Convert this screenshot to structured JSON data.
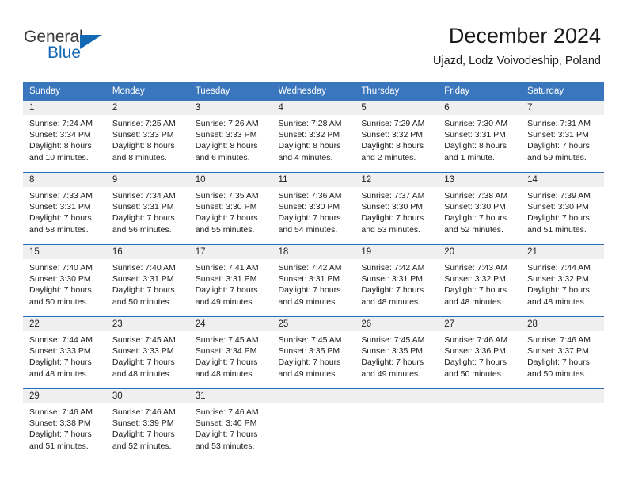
{
  "brand": {
    "name_part1": "General",
    "name_part2": "Blue",
    "triangle_color": "#1268b3"
  },
  "header": {
    "title": "December 2024",
    "subtitle": "Ujazd, Lodz Voivodeship, Poland"
  },
  "theme": {
    "header_bg": "#3a76bd",
    "row_divider": "#2f6eb5",
    "daynum_band_bg": "#efeff0",
    "page_bg": "#ffffff"
  },
  "weekday_headers": [
    "Sunday",
    "Monday",
    "Tuesday",
    "Wednesday",
    "Thursday",
    "Friday",
    "Saturday"
  ],
  "weeks": [
    [
      {
        "day": "1",
        "sunrise": "Sunrise: 7:24 AM",
        "sunset": "Sunset: 3:34 PM",
        "daylight_line1": "Daylight: 8 hours",
        "daylight_line2": "and 10 minutes."
      },
      {
        "day": "2",
        "sunrise": "Sunrise: 7:25 AM",
        "sunset": "Sunset: 3:33 PM",
        "daylight_line1": "Daylight: 8 hours",
        "daylight_line2": "and 8 minutes."
      },
      {
        "day": "3",
        "sunrise": "Sunrise: 7:26 AM",
        "sunset": "Sunset: 3:33 PM",
        "daylight_line1": "Daylight: 8 hours",
        "daylight_line2": "and 6 minutes."
      },
      {
        "day": "4",
        "sunrise": "Sunrise: 7:28 AM",
        "sunset": "Sunset: 3:32 PM",
        "daylight_line1": "Daylight: 8 hours",
        "daylight_line2": "and 4 minutes."
      },
      {
        "day": "5",
        "sunrise": "Sunrise: 7:29 AM",
        "sunset": "Sunset: 3:32 PM",
        "daylight_line1": "Daylight: 8 hours",
        "daylight_line2": "and 2 minutes."
      },
      {
        "day": "6",
        "sunrise": "Sunrise: 7:30 AM",
        "sunset": "Sunset: 3:31 PM",
        "daylight_line1": "Daylight: 8 hours",
        "daylight_line2": "and 1 minute."
      },
      {
        "day": "7",
        "sunrise": "Sunrise: 7:31 AM",
        "sunset": "Sunset: 3:31 PM",
        "daylight_line1": "Daylight: 7 hours",
        "daylight_line2": "and 59 minutes."
      }
    ],
    [
      {
        "day": "8",
        "sunrise": "Sunrise: 7:33 AM",
        "sunset": "Sunset: 3:31 PM",
        "daylight_line1": "Daylight: 7 hours",
        "daylight_line2": "and 58 minutes."
      },
      {
        "day": "9",
        "sunrise": "Sunrise: 7:34 AM",
        "sunset": "Sunset: 3:31 PM",
        "daylight_line1": "Daylight: 7 hours",
        "daylight_line2": "and 56 minutes."
      },
      {
        "day": "10",
        "sunrise": "Sunrise: 7:35 AM",
        "sunset": "Sunset: 3:30 PM",
        "daylight_line1": "Daylight: 7 hours",
        "daylight_line2": "and 55 minutes."
      },
      {
        "day": "11",
        "sunrise": "Sunrise: 7:36 AM",
        "sunset": "Sunset: 3:30 PM",
        "daylight_line1": "Daylight: 7 hours",
        "daylight_line2": "and 54 minutes."
      },
      {
        "day": "12",
        "sunrise": "Sunrise: 7:37 AM",
        "sunset": "Sunset: 3:30 PM",
        "daylight_line1": "Daylight: 7 hours",
        "daylight_line2": "and 53 minutes."
      },
      {
        "day": "13",
        "sunrise": "Sunrise: 7:38 AM",
        "sunset": "Sunset: 3:30 PM",
        "daylight_line1": "Daylight: 7 hours",
        "daylight_line2": "and 52 minutes."
      },
      {
        "day": "14",
        "sunrise": "Sunrise: 7:39 AM",
        "sunset": "Sunset: 3:30 PM",
        "daylight_line1": "Daylight: 7 hours",
        "daylight_line2": "and 51 minutes."
      }
    ],
    [
      {
        "day": "15",
        "sunrise": "Sunrise: 7:40 AM",
        "sunset": "Sunset: 3:30 PM",
        "daylight_line1": "Daylight: 7 hours",
        "daylight_line2": "and 50 minutes."
      },
      {
        "day": "16",
        "sunrise": "Sunrise: 7:40 AM",
        "sunset": "Sunset: 3:31 PM",
        "daylight_line1": "Daylight: 7 hours",
        "daylight_line2": "and 50 minutes."
      },
      {
        "day": "17",
        "sunrise": "Sunrise: 7:41 AM",
        "sunset": "Sunset: 3:31 PM",
        "daylight_line1": "Daylight: 7 hours",
        "daylight_line2": "and 49 minutes."
      },
      {
        "day": "18",
        "sunrise": "Sunrise: 7:42 AM",
        "sunset": "Sunset: 3:31 PM",
        "daylight_line1": "Daylight: 7 hours",
        "daylight_line2": "and 49 minutes."
      },
      {
        "day": "19",
        "sunrise": "Sunrise: 7:42 AM",
        "sunset": "Sunset: 3:31 PM",
        "daylight_line1": "Daylight: 7 hours",
        "daylight_line2": "and 48 minutes."
      },
      {
        "day": "20",
        "sunrise": "Sunrise: 7:43 AM",
        "sunset": "Sunset: 3:32 PM",
        "daylight_line1": "Daylight: 7 hours",
        "daylight_line2": "and 48 minutes."
      },
      {
        "day": "21",
        "sunrise": "Sunrise: 7:44 AM",
        "sunset": "Sunset: 3:32 PM",
        "daylight_line1": "Daylight: 7 hours",
        "daylight_line2": "and 48 minutes."
      }
    ],
    [
      {
        "day": "22",
        "sunrise": "Sunrise: 7:44 AM",
        "sunset": "Sunset: 3:33 PM",
        "daylight_line1": "Daylight: 7 hours",
        "daylight_line2": "and 48 minutes."
      },
      {
        "day": "23",
        "sunrise": "Sunrise: 7:45 AM",
        "sunset": "Sunset: 3:33 PM",
        "daylight_line1": "Daylight: 7 hours",
        "daylight_line2": "and 48 minutes."
      },
      {
        "day": "24",
        "sunrise": "Sunrise: 7:45 AM",
        "sunset": "Sunset: 3:34 PM",
        "daylight_line1": "Daylight: 7 hours",
        "daylight_line2": "and 48 minutes."
      },
      {
        "day": "25",
        "sunrise": "Sunrise: 7:45 AM",
        "sunset": "Sunset: 3:35 PM",
        "daylight_line1": "Daylight: 7 hours",
        "daylight_line2": "and 49 minutes."
      },
      {
        "day": "26",
        "sunrise": "Sunrise: 7:45 AM",
        "sunset": "Sunset: 3:35 PM",
        "daylight_line1": "Daylight: 7 hours",
        "daylight_line2": "and 49 minutes."
      },
      {
        "day": "27",
        "sunrise": "Sunrise: 7:46 AM",
        "sunset": "Sunset: 3:36 PM",
        "daylight_line1": "Daylight: 7 hours",
        "daylight_line2": "and 50 minutes."
      },
      {
        "day": "28",
        "sunrise": "Sunrise: 7:46 AM",
        "sunset": "Sunset: 3:37 PM",
        "daylight_line1": "Daylight: 7 hours",
        "daylight_line2": "and 50 minutes."
      }
    ],
    [
      {
        "day": "29",
        "sunrise": "Sunrise: 7:46 AM",
        "sunset": "Sunset: 3:38 PM",
        "daylight_line1": "Daylight: 7 hours",
        "daylight_line2": "and 51 minutes."
      },
      {
        "day": "30",
        "sunrise": "Sunrise: 7:46 AM",
        "sunset": "Sunset: 3:39 PM",
        "daylight_line1": "Daylight: 7 hours",
        "daylight_line2": "and 52 minutes."
      },
      {
        "day": "31",
        "sunrise": "Sunrise: 7:46 AM",
        "sunset": "Sunset: 3:40 PM",
        "daylight_line1": "Daylight: 7 hours",
        "daylight_line2": "and 53 minutes."
      },
      {
        "day": "",
        "sunrise": "",
        "sunset": "",
        "daylight_line1": "",
        "daylight_line2": ""
      },
      {
        "day": "",
        "sunrise": "",
        "sunset": "",
        "daylight_line1": "",
        "daylight_line2": ""
      },
      {
        "day": "",
        "sunrise": "",
        "sunset": "",
        "daylight_line1": "",
        "daylight_line2": ""
      },
      {
        "day": "",
        "sunrise": "",
        "sunset": "",
        "daylight_line1": "",
        "daylight_line2": ""
      }
    ]
  ]
}
